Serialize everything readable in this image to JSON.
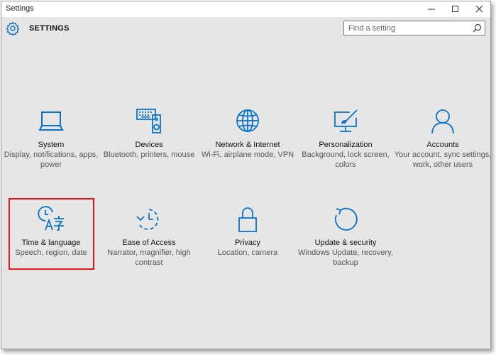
{
  "window": {
    "title": "Settings"
  },
  "header": {
    "title": "SETTINGS",
    "search_placeholder": "Find a setting"
  },
  "accent_color": "#0a72c8",
  "highlight_color": "#e8121b",
  "tiles": [
    {
      "icon": "laptop-icon",
      "name": "System",
      "desc": "Display, notifications, apps, power"
    },
    {
      "icon": "keyboard-speaker-icon",
      "name": "Devices",
      "desc": "Bluetooth, printers, mouse"
    },
    {
      "icon": "globe-icon",
      "name": "Network & Internet",
      "desc": "Wi-Fi, airplane mode, VPN"
    },
    {
      "icon": "paint-monitor-icon",
      "name": "Personalization",
      "desc": "Background, lock screen, colors"
    },
    {
      "icon": "person-icon",
      "name": "Accounts",
      "desc": "Your account, sync settings, work, other users"
    },
    {
      "icon": "time-language-icon",
      "name": "Time & language",
      "desc": "Speech, region, date",
      "highlighted": true
    },
    {
      "icon": "ease-of-access-icon",
      "name": "Ease of Access",
      "desc": "Narrator, magnifier, high contrast"
    },
    {
      "icon": "lock-icon",
      "name": "Privacy",
      "desc": "Location, camera"
    },
    {
      "icon": "refresh-icon",
      "name": "Update & security",
      "desc": "Windows Update, recovery, backup"
    }
  ]
}
